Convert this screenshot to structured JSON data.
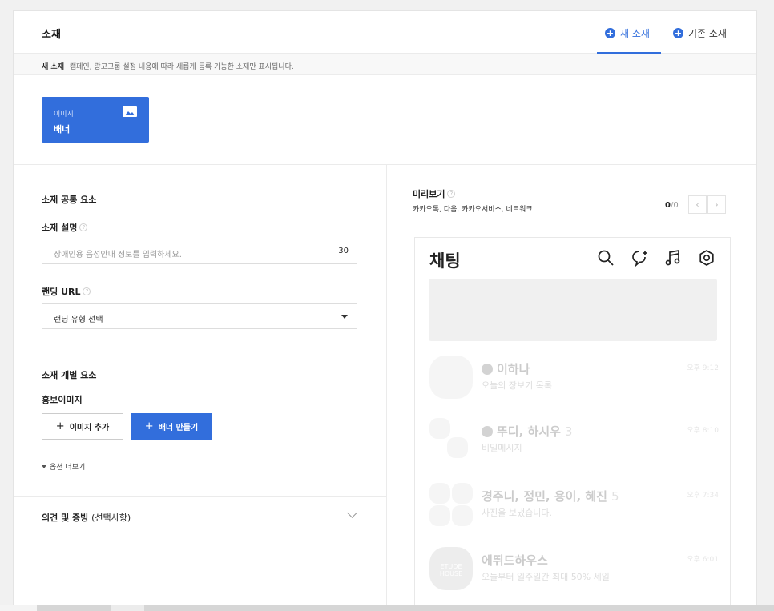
{
  "header": {
    "title": "소재",
    "tabs": [
      {
        "label": "새 소재",
        "active": true
      },
      {
        "label": "기존 소재",
        "active": false
      }
    ]
  },
  "info_bar": {
    "label": "새 소재",
    "text": "캠페인, 광고그룹 설정 내용에 따라 새롭게 등록 가능한 소재만 표시됩니다."
  },
  "creative_type": {
    "category": "이미지",
    "name": "배너",
    "icon": "image-icon"
  },
  "common": {
    "section_title": "소재 공통 요소",
    "description_label": "소재 설명",
    "description_placeholder": "장애인용 음성안내 정보를 입력하세요.",
    "description_count": "30",
    "landing_label": "랜딩 URL",
    "landing_select": "랜딩 유형 선택"
  },
  "individual": {
    "section_title": "소재 개별 요소",
    "promo_label": "홍보이미지",
    "add_image_button": "이미지 추가",
    "make_banner_button": "배너 만들기",
    "more_options": "옵션 더보기"
  },
  "opinion": {
    "label": "의견 및 증빙",
    "optional": "(선택사항)"
  },
  "preview": {
    "title": "미리보기",
    "platforms": "카카오톡, 다음, 카카오서비스, 네트워크",
    "current": "0",
    "total": "/0",
    "prev": "‹",
    "next": "›",
    "phone": {
      "title": "채팅",
      "icons": [
        "search-icon",
        "new-chat-icon",
        "music-icon",
        "settings-icon"
      ],
      "chats": [
        {
          "name": "이하나",
          "count": "",
          "message": "오늘의 장보기 목록",
          "time": "오후 9:12"
        },
        {
          "name": "뚜디, 하시우",
          "count": "3",
          "message": "비밀메시지",
          "time": "오후 8:10"
        },
        {
          "name": "경주니, 정민, 용이, 혜진",
          "count": "5",
          "message": "사진을 보냈습니다.",
          "time": "오후 7:34"
        },
        {
          "name": "에뛰드하우스",
          "count": "",
          "message": "오늘부터 일주일간 최대 50% 세일",
          "time": "오후 6:01"
        }
      ],
      "brand_logo_text": "ETUDE HOUSE"
    }
  }
}
